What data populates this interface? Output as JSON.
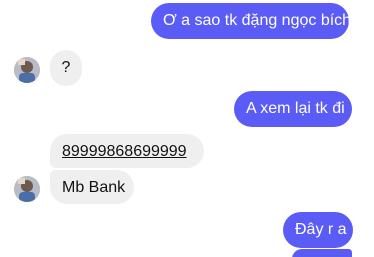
{
  "messages": [
    {
      "text": "Ơ a sao tk đặng ngọc bích"
    },
    {
      "text": "?"
    },
    {
      "text": "A xem lại tk đi"
    },
    {
      "text": "89999868699999"
    },
    {
      "text": "Mb Bank"
    },
    {
      "text": "Đây r a"
    }
  ],
  "colors": {
    "outgoing_bubble": "#5b5cf6",
    "incoming_bubble": "#efefef"
  }
}
